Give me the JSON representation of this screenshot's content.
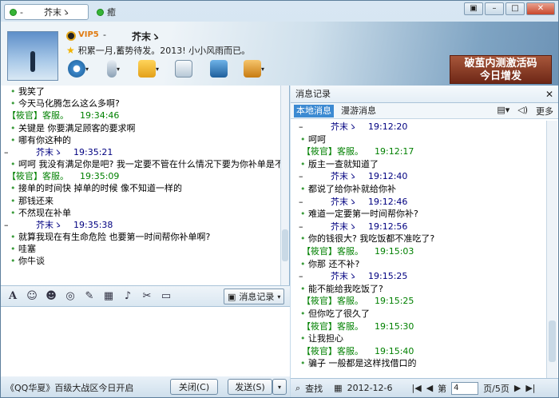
{
  "tabs": [
    {
      "label": "-"
    },
    {
      "label": "芥末ゝ"
    },
    {
      "label": "癒"
    }
  ],
  "header": {
    "vip": "VIP5",
    "nick_prefix": "-",
    "nick": "芥末ゝ",
    "mood": "积累一月,蓄势待发。2013! 小小风雨而已。",
    "ad_line1": "破茧内测激活码",
    "ad_line2": "今日增发"
  },
  "toolbar_icons": [
    "video-icon",
    "voice-icon",
    "file-transfer-icon",
    "sms-icon",
    "remote-assist-icon",
    "app-box-icon"
  ],
  "chat": [
    {
      "type": "msg",
      "text": "我笑了"
    },
    {
      "type": "msg",
      "text": "今天马化腾怎么这么多啊?"
    },
    {
      "type": "hdr",
      "name": "【筱官】客服。",
      "time": "19:34:46"
    },
    {
      "type": "msg",
      "text": "关键是  你要满足顾客的要求啊"
    },
    {
      "type": "msg",
      "text": "哪有你这种的"
    },
    {
      "type": "me",
      "name": "芥末ゝ",
      "time": "19:35:21"
    },
    {
      "type": "wrap",
      "text": "呵呵  我没有满足你是吧? 我一定要不管在什么情况下要为你补单是不?"
    },
    {
      "type": "hdr",
      "name": "【筱官】客服。",
      "time": "19:35:09"
    },
    {
      "type": "msg",
      "text": "接单的时间快  掉单的时候  像不知道一样的"
    },
    {
      "type": "msg",
      "text": "那钱还来"
    },
    {
      "type": "msg",
      "text": "不然现在补单"
    },
    {
      "type": "me",
      "name": "芥末ゝ",
      "time": "19:35:38"
    },
    {
      "type": "msg",
      "text": "就算我现在有生命危险  也要第一时间帮你补单啊?"
    },
    {
      "type": "msg",
      "text": "哇塞"
    },
    {
      "type": "msg",
      "text": "你牛谈"
    }
  ],
  "input_toolbar": {
    "msg_record_label": "消息记录"
  },
  "bottom": {
    "ticker": "《QQ华夏》百级大战区今日开启",
    "close_label": "关闭(C)",
    "send_label": "发送(S)"
  },
  "history": {
    "title": "消息记录",
    "tab_local": "本地消息",
    "tab_roam": "漫游消息",
    "more": "更多",
    "lines": [
      {
        "type": "me",
        "name": "芥末ゝ",
        "time": "19:12:20"
      },
      {
        "type": "txt",
        "text": "呵呵"
      },
      {
        "type": "other",
        "name": "【筱官】客服。",
        "time": "19:12:17"
      },
      {
        "type": "txt",
        "text": "版主一查就知道了"
      },
      {
        "type": "me",
        "name": "芥末ゝ",
        "time": "19:12:40"
      },
      {
        "type": "txt",
        "text": "都说了给你补就给你补"
      },
      {
        "type": "me",
        "name": "芥末ゝ",
        "time": "19:12:46"
      },
      {
        "type": "txt",
        "text": "难道一定要第一时间帮你补?"
      },
      {
        "type": "me",
        "name": "芥末ゝ",
        "time": "19:12:56"
      },
      {
        "type": "txt",
        "text": "你的钱很大? 我吃饭都不准吃了?"
      },
      {
        "type": "other",
        "name": "【筱官】客服。",
        "time": "19:15:03"
      },
      {
        "type": "txt",
        "text": "你那  还不补?"
      },
      {
        "type": "me",
        "name": "芥末ゝ",
        "time": "19:15:25"
      },
      {
        "type": "txt",
        "text": "能不能给我吃饭了?"
      },
      {
        "type": "other",
        "name": "【筱官】客服。",
        "time": "19:15:25"
      },
      {
        "type": "txt",
        "text": "但你吃了很久了"
      },
      {
        "type": "other",
        "name": "【筱官】客服。",
        "time": "19:15:30"
      },
      {
        "type": "txt",
        "text": "让我担心"
      },
      {
        "type": "other",
        "name": "【筱官】客服。",
        "time": "19:15:40"
      },
      {
        "type": "txt",
        "text": "骗子  一般都是这样找借口的"
      }
    ],
    "footer": {
      "find": "查找",
      "date": "2012-12-6",
      "page_prefix": "第",
      "page": "4",
      "page_suffix": "页/5页"
    }
  },
  "colors": {
    "accent": "#3c8ad2",
    "name_green": "#008000",
    "name_blue": "#000080"
  }
}
